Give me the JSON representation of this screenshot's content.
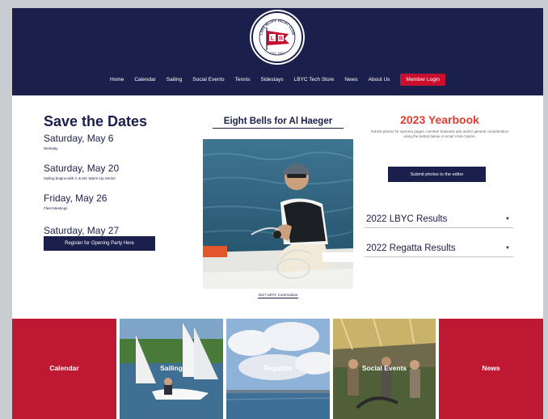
{
  "header": {
    "logo_text_top": "LAKE BLUFF YACHT CLUB",
    "logo_text_bottom": "EST. 1963",
    "logo_letters": "LB"
  },
  "nav": {
    "items": [
      "Home",
      "Calendar",
      "Sailing",
      "Social Events",
      "Tennis",
      "Sidestays",
      "LBYC Tech Store",
      "News",
      "About Us"
    ],
    "member_login": "Member Login"
  },
  "save_dates": {
    "title": "Save the Dates",
    "dates": [
      {
        "date": "Saturday, May 6",
        "note": "Workday"
      },
      {
        "date": "Saturday, May 20",
        "note": "Sailing begins with C & MC Warm-Up Series"
      },
      {
        "date": "Friday, May 26",
        "note": "Fleet Meetings"
      },
      {
        "date": "Saturday, May 27",
        "note": ""
      }
    ],
    "register_button": "Register for Opening Party Here"
  },
  "feature": {
    "title": "Eight Bells for Al Haeger",
    "caption": "2017 LBYC Commodore"
  },
  "yearbook": {
    "title": "2023 Yearbook",
    "text": "Submit photos for sponsor pages, member business ads and/or general consideration using the button below or email Vicki Cayton.",
    "submit_button": "Submit photos to the editor"
  },
  "results": [
    {
      "label": "2022 LBYC Results"
    },
    {
      "label": "2022 Regatta Results"
    }
  ],
  "tiles": [
    "Calendar",
    "Sailing",
    "Regattas",
    "Social Events",
    "News"
  ],
  "colors": {
    "navy": "#1b1f4b",
    "red": "#c8102e",
    "yearbook_red": "#e03c31",
    "tile_red": "#be1833"
  }
}
